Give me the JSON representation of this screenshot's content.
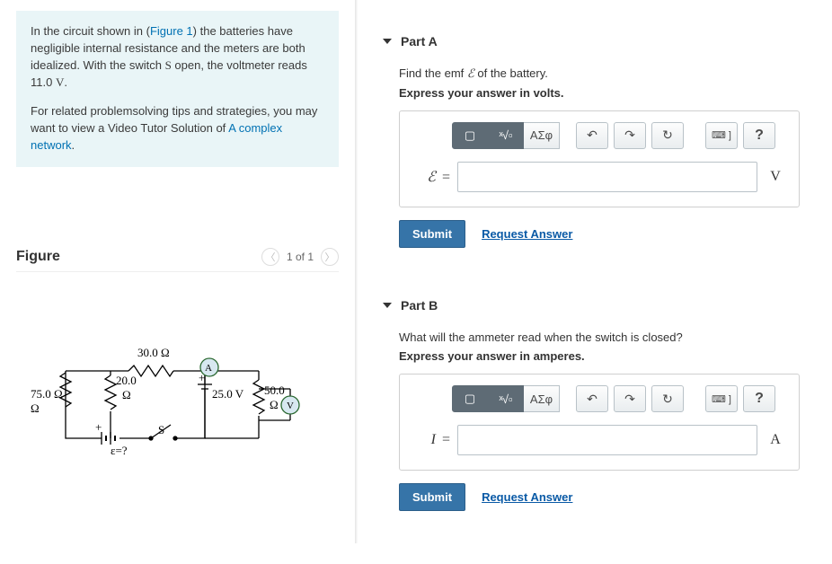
{
  "intro": {
    "p1a": "In the circuit shown in (",
    "fig_link": "Figure 1",
    "p1b": ") the batteries have negligible internal resistance and the meters are both idealized. With the switch ",
    "switch_sym": "S",
    "p1c": " open, the voltmeter reads 11.0 ",
    "volt_sym": "V",
    "p1d": ".",
    "p2a": "For related problemsolving tips and strategies, you may want to view a Video Tutor Solution of ",
    "tutor_link": "A complex network",
    "p2b": "."
  },
  "figure": {
    "heading": "Figure",
    "pager_text": "1 of 1",
    "labels": {
      "r_top": "30.0 Ω",
      "r_left": "75.0 Ω",
      "r_mid1": "20.0",
      "r_mid2": "Ω",
      "v_src": "25.0 V",
      "r_right1": "50.0",
      "r_right2": "Ω",
      "emf": "ε=?",
      "switch": "S",
      "ammeter": "A",
      "voltmeter": "V"
    }
  },
  "toolbar": {
    "template": "▢",
    "sqrt": "√x",
    "frac": "x̌",
    "greek": "ΑΣφ",
    "undo": "↶",
    "redo": "↷",
    "reset": "↻",
    "keyboard": "⌨ ]",
    "help": "?"
  },
  "partA": {
    "title": "Part A",
    "prompt_a": "Find the emf ",
    "emf_sym": "ℰ",
    "prompt_b": " of the battery.",
    "bold": "Express your answer in volts.",
    "lhs": "ℰ",
    "unit": "V",
    "submit": "Submit",
    "request": "Request Answer"
  },
  "partB": {
    "title": "Part B",
    "prompt": "What will the ammeter read when the switch is closed?",
    "bold": "Express your answer in amperes.",
    "lhs": "I",
    "unit": "A",
    "submit": "Submit",
    "request": "Request Answer"
  }
}
